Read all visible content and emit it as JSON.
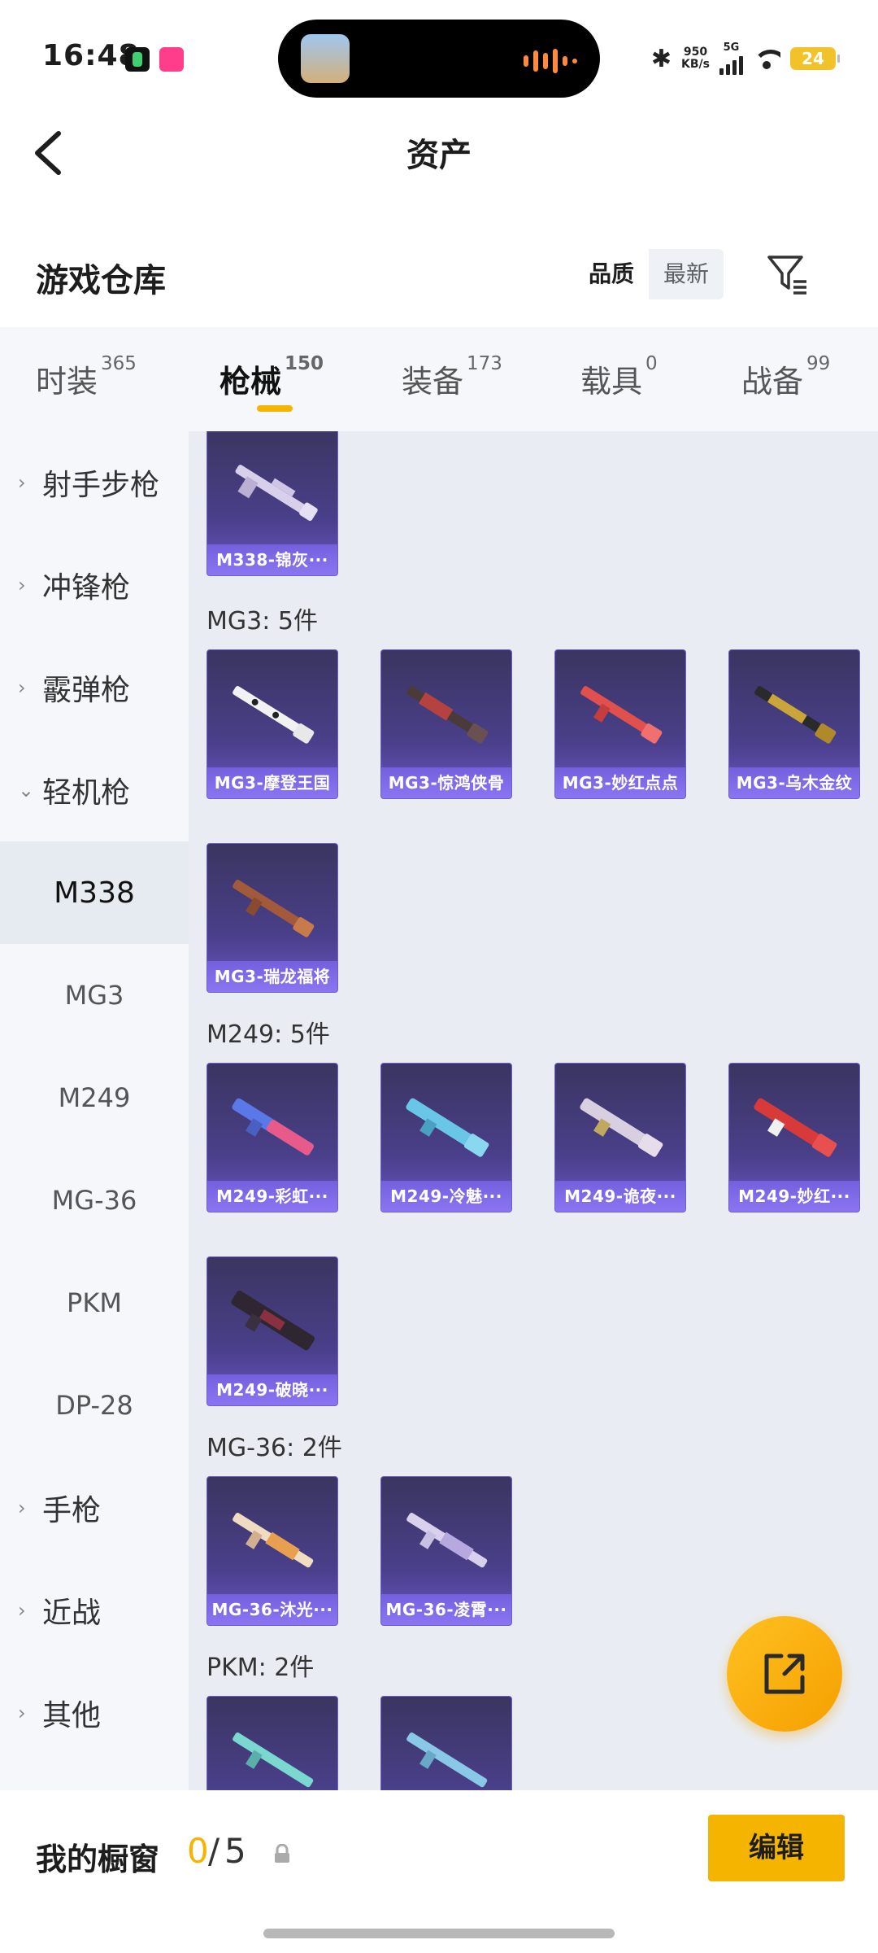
{
  "status_bar": {
    "time": "16:48",
    "net_speed_value": "950",
    "net_speed_unit": "KB/s",
    "network": "5G",
    "battery": "24"
  },
  "header": {
    "title": "资产",
    "back_icon": "chevron-left-icon"
  },
  "warehouse": {
    "title": "游戏仓库",
    "sort_options": [
      "品质",
      "最新"
    ],
    "active_sort": "品质",
    "filter_icon": "filter-icon"
  },
  "tabs": [
    {
      "label": "时装",
      "count": "365"
    },
    {
      "label": "枪械",
      "count": "150",
      "active": true
    },
    {
      "label": "装备",
      "count": "173"
    },
    {
      "label": "载具",
      "count": "0"
    },
    {
      "label": "战备",
      "count": "99"
    }
  ],
  "sidebar": {
    "items": [
      {
        "label": "射手步枪",
        "type": "category",
        "expanded": false
      },
      {
        "label": "冲锋枪",
        "type": "category",
        "expanded": false
      },
      {
        "label": "霰弹枪",
        "type": "category",
        "expanded": false
      },
      {
        "label": "轻机枪",
        "type": "category",
        "expanded": true
      },
      {
        "label": "M338",
        "type": "sub",
        "active": true
      },
      {
        "label": "MG3",
        "type": "sub"
      },
      {
        "label": "M249",
        "type": "sub"
      },
      {
        "label": "MG-36",
        "type": "sub"
      },
      {
        "label": "PKM",
        "type": "sub"
      },
      {
        "label": "DP-28",
        "type": "sub"
      },
      {
        "label": "手枪",
        "type": "category",
        "expanded": false
      },
      {
        "label": "近战",
        "type": "category",
        "expanded": false
      },
      {
        "label": "其他",
        "type": "category",
        "expanded": false
      }
    ]
  },
  "content": {
    "groups": [
      {
        "header": "",
        "items": [
          "M338-锦灰···"
        ]
      },
      {
        "header": "MG3: 5件",
        "items": [
          "MG3-摩登王国",
          "MG3-惊鸿侠骨",
          "MG3-妙红点点",
          "MG3-乌木金纹",
          "MG3-瑞龙福将"
        ]
      },
      {
        "header": "M249: 5件",
        "items": [
          "M249-彩虹···",
          "M249-冷魅···",
          "M249-诡夜···",
          "M249-妙红···",
          "M249-破晓···"
        ]
      },
      {
        "header": "MG-36: 2件",
        "items": [
          "MG-36-沐光···",
          "MG-36-凌霄···"
        ]
      },
      {
        "header": "PKM: 2件",
        "items": [
          "",
          ""
        ]
      }
    ]
  },
  "fab": {
    "icon": "share-export-icon"
  },
  "bottom_bar": {
    "title": "我的橱窗",
    "count_current": "0",
    "count_separator": "/",
    "count_max": "5",
    "lock_icon": "lock-icon",
    "edit_label": "编辑"
  },
  "colors": {
    "accent": "#f5b400",
    "card_bg": "#4a3f8a",
    "card_label": "#8a73f0",
    "page_bg": "#e9edf3",
    "sidebar_bg": "#f5f7fa"
  }
}
